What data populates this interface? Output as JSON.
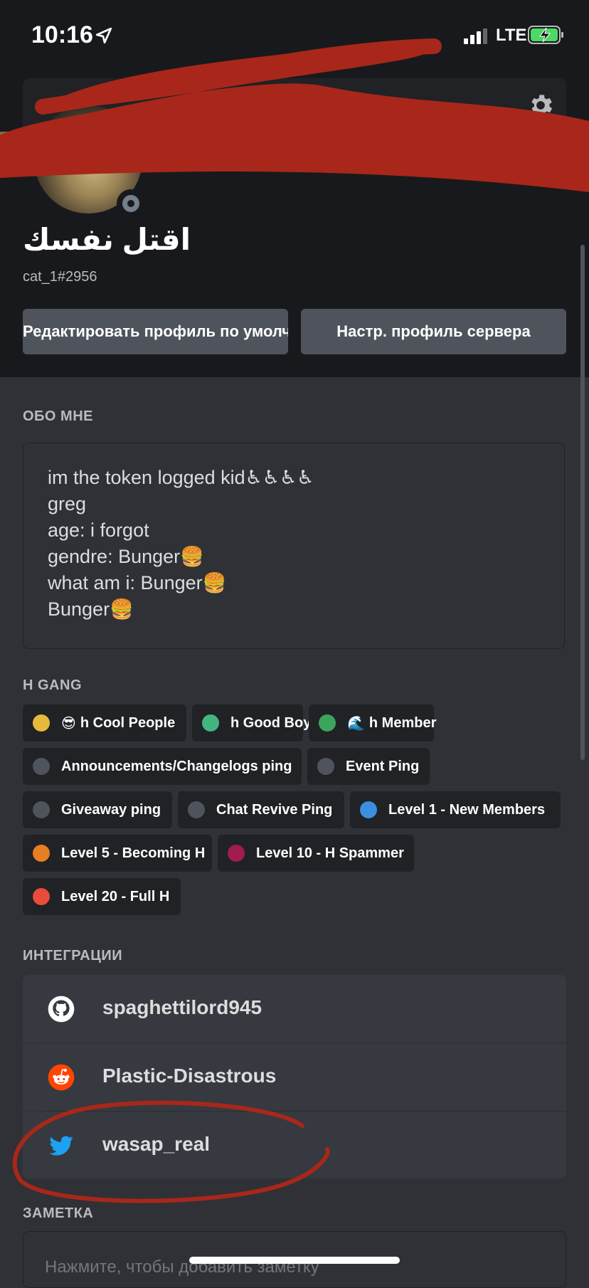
{
  "status_bar": {
    "time": "10:16",
    "network": "LTE"
  },
  "profile": {
    "display_name": "اقتل نفسك",
    "tag": "cat_1#2956",
    "edit_button": "Редактировать профиль по умолчанию",
    "server_button": "Настр. профиль сервера"
  },
  "about": {
    "heading": "ОБО МНЕ",
    "lines": [
      "im the token logged kid♿♿♿♿",
      "greg",
      "age: i forgot",
      "gendre: Bunger🍔",
      "what am i: Bunger🍔",
      "Bunger🍔"
    ]
  },
  "roles": {
    "heading": "H GANG",
    "items": [
      {
        "label": "h Cool People",
        "emoji": "😎",
        "color": "#e6b93a"
      },
      {
        "label": "h Good Boy",
        "emoji": "",
        "color": "#43b581"
      },
      {
        "label": "h Member",
        "emoji": "🌊",
        "color": "#3ba55c"
      },
      {
        "label": "Announcements/Changelogs ping",
        "emoji": "",
        "color": "#4f545c"
      },
      {
        "label": "Event Ping",
        "emoji": "",
        "color": "#4f545c"
      },
      {
        "label": "Giveaway ping",
        "emoji": "",
        "color": "#4f545c"
      },
      {
        "label": "Chat Revive Ping",
        "emoji": "",
        "color": "#4f545c"
      },
      {
        "label": "Level 1 - New Members",
        "emoji": "",
        "color": "#3b8fdf"
      },
      {
        "label": "Level 5 - Becoming H",
        "emoji": "",
        "color": "#e67e22"
      },
      {
        "label": "Level 10 - H Spammer",
        "emoji": "",
        "color": "#a21c50"
      },
      {
        "label": "Level 20 - Full H",
        "emoji": "",
        "color": "#e74c3c"
      }
    ]
  },
  "integrations": {
    "heading": "ИНТЕГРАЦИИ",
    "items": [
      {
        "name": "spaghettilord945",
        "icon": "github-icon"
      },
      {
        "name": "Plastic-Disastrous",
        "icon": "reddit-icon"
      },
      {
        "name": "wasap_real",
        "icon": "twitter-icon"
      }
    ]
  },
  "note": {
    "heading": "ЗАМЕТКА",
    "placeholder": "Нажмите, чтобы добавить заметку"
  },
  "colors": {
    "background": "#2f3136",
    "header": "#18191c",
    "card": "#202225",
    "button": "#4f545c",
    "redaction": "#a8271a"
  }
}
